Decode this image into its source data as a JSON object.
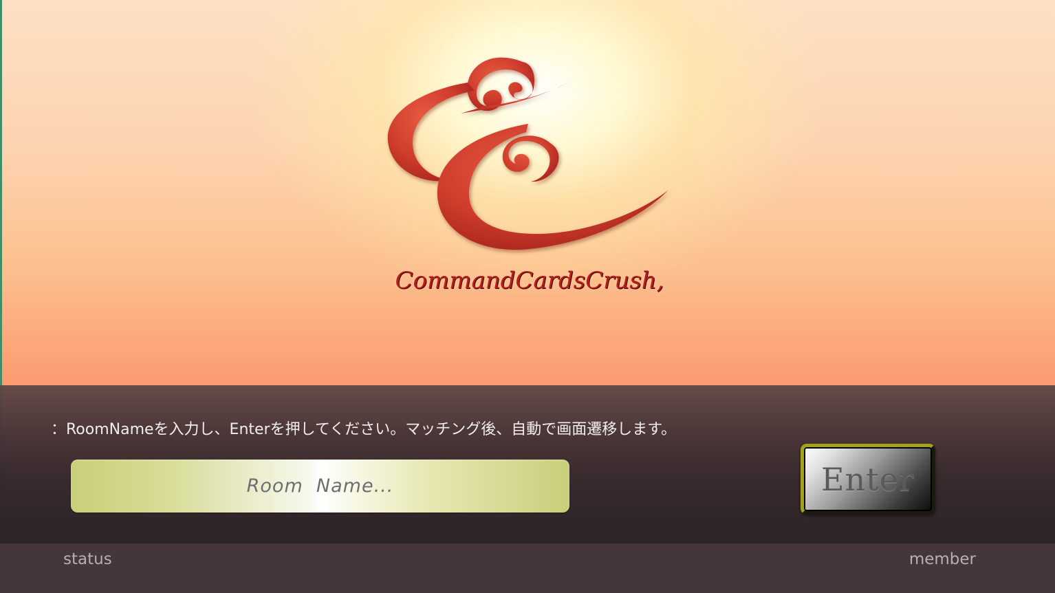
{
  "logo": {
    "icon": "ornate-double-e-logo",
    "text": "CommandCardsCrush,"
  },
  "instruction": "：RoomNameを入力し、Enterを押してください。マッチング後、自動で画面遷移します。",
  "room_input": {
    "placeholder": "Room  Name...",
    "value": ""
  },
  "enter_button": {
    "label": "Enter"
  },
  "footer": {
    "status": "status",
    "member": "member"
  },
  "colors": {
    "logo_red": "#c8392b",
    "input_accent": "#c9cf78",
    "button_border": "#a4a21a",
    "panel_dark": "#2c2428"
  }
}
